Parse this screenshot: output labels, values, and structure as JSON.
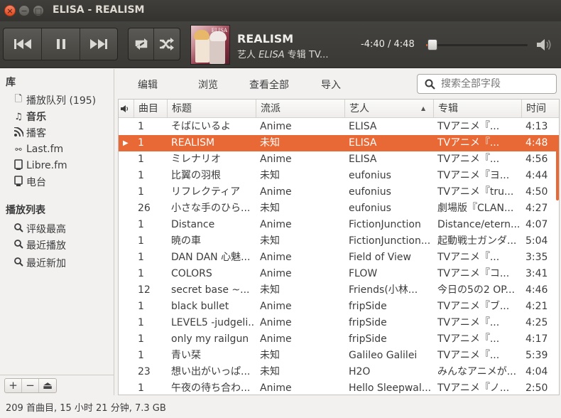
{
  "window": {
    "title": "ELISA - REALISM"
  },
  "now_playing": {
    "title": "REALISM",
    "subtitle_prefix": "艺人",
    "artist": "ELISA",
    "subtitle_mid": "专辑",
    "album": "TV...",
    "time": "-4:40 / 4:48",
    "progress": 0.03,
    "art_text": "ELISA"
  },
  "sidebar": {
    "library_header": "库",
    "library_items": [
      {
        "label": "播放队列 (195)",
        "icon": "document-icon"
      },
      {
        "label": "音乐",
        "icon": "music-note-icon"
      },
      {
        "label": "播客",
        "icon": "rss-icon"
      },
      {
        "label": "Last.fm",
        "icon": "lastfm-icon"
      },
      {
        "label": "Libre.fm",
        "icon": "device-icon"
      },
      {
        "label": "电台",
        "icon": "radio-icon"
      }
    ],
    "playlists_header": "播放列表",
    "playlist_items": [
      {
        "label": "评级最高",
        "icon": "search-icon"
      },
      {
        "label": "最近播放",
        "icon": "search-icon"
      },
      {
        "label": "最近新加",
        "icon": "search-icon"
      }
    ],
    "bottom_buttons": [
      "+",
      "−",
      "⏏"
    ]
  },
  "subbar": {
    "edit": "编辑",
    "browse": "浏览",
    "view_all": "查看全部",
    "import": "导入",
    "search_placeholder": "搜索全部字段"
  },
  "table": {
    "columns": [
      "曲目",
      "标题",
      "流派",
      "艺人",
      "专辑",
      "时间"
    ],
    "sort_indicator": "▲",
    "rows": [
      {
        "track": "1",
        "title": "そばにいるよ",
        "genre": "Anime",
        "artist": "ELISA",
        "album": "TVアニメ『...",
        "time": "4:13"
      },
      {
        "track": "1",
        "title": "REALISM",
        "genre": "未知",
        "artist": "ELISA",
        "album": "TVアニメ『...",
        "time": "4:48",
        "playing": true
      },
      {
        "track": "1",
        "title": "ミレナリオ",
        "genre": "Anime",
        "artist": "ELISA",
        "album": "TVアニメ『...",
        "time": "4:56"
      },
      {
        "track": "1",
        "title": "比翼の羽根",
        "genre": "未知",
        "artist": "eufonius",
        "album": "TVアニメ『ヨ...",
        "time": "4:44"
      },
      {
        "track": "1",
        "title": "リフレクティア",
        "genre": "Anime",
        "artist": "eufonius",
        "album": "TVアニメ『tru...",
        "time": "4:50"
      },
      {
        "track": "26",
        "title": "小さな手のひら...",
        "genre": "未知",
        "artist": "eufonius",
        "album": "劇場版『CLAN...",
        "time": "4:27"
      },
      {
        "track": "1",
        "title": "Distance",
        "genre": "Anime",
        "artist": "FictionJunction",
        "album": "Distance/etern...",
        "time": "4:07"
      },
      {
        "track": "1",
        "title": "暁の車",
        "genre": "未知",
        "artist": "FictionJunction...",
        "album": "起動戦士ガンダ...",
        "time": "5:04"
      },
      {
        "track": "1",
        "title": "DAN DAN 心魅...",
        "genre": "Anime",
        "artist": "Field of View",
        "album": "TVアニメ『...",
        "time": "3:35"
      },
      {
        "track": "1",
        "title": "COLORS",
        "genre": "Anime",
        "artist": "FLOW",
        "album": "TVアニメ『コ...",
        "time": "3:41"
      },
      {
        "track": "12",
        "title": "secret base ~...",
        "genre": "未知",
        "artist": "Friends(小林...",
        "album": "今日の5の2 OP...",
        "time": "4:46"
      },
      {
        "track": "1",
        "title": "black bullet",
        "genre": "Anime",
        "artist": "fripSide",
        "album": "TVアニメ『ブ...",
        "time": "4:21"
      },
      {
        "track": "1",
        "title": "LEVEL5 -judgeli...",
        "genre": "Anime",
        "artist": "fripSide",
        "album": "TVアニメ『...",
        "time": "4:25"
      },
      {
        "track": "1",
        "title": "only my railgun",
        "genre": "Anime",
        "artist": "fripSide",
        "album": "TVアニメ『...",
        "time": "4:17"
      },
      {
        "track": "1",
        "title": "青い栞",
        "genre": "未知",
        "artist": "Galileo Galilei",
        "album": "TVアニメ『...",
        "time": "5:39"
      },
      {
        "track": "23",
        "title": "想い出がいっぱ...",
        "genre": "未知",
        "artist": "H2O",
        "album": "みんなアニメが...",
        "time": "4:04"
      },
      {
        "track": "1",
        "title": "午夜の待ち合わ...",
        "genre": "Anime",
        "artist": "Hello Sleepwal...",
        "album": "TVアニメ『ノ...",
        "time": "2:50"
      }
    ]
  },
  "status": {
    "summary": "209 首曲目, 15 小时 21 分钟, 7.3 GB"
  },
  "colors": {
    "accent": "#e86936",
    "titlebar": "#3c3b37"
  }
}
